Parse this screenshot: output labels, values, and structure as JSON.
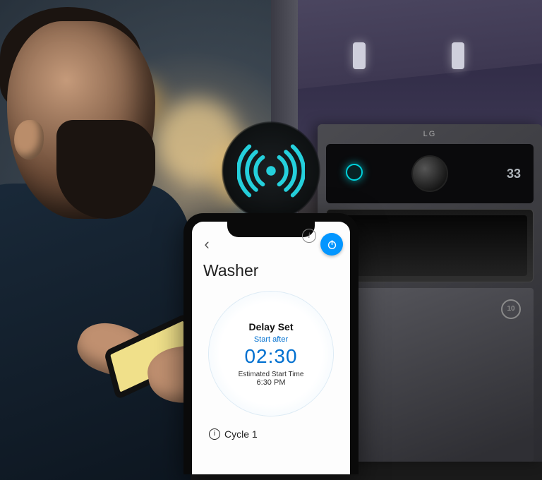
{
  "washer": {
    "brand": "LG",
    "panel_readout": "33",
    "badge": "10"
  },
  "phone_app": {
    "title": "Washer",
    "info_glyph": "i",
    "back_glyph": "‹",
    "status": {
      "heading": "Delay Set",
      "sub_label": "Start after",
      "timer": "02:30",
      "estimate_label": "Estimated Start Time",
      "estimate_time": "6:30 PM"
    },
    "cycle": {
      "icon_glyph": "i",
      "label": "Cycle 1"
    }
  }
}
